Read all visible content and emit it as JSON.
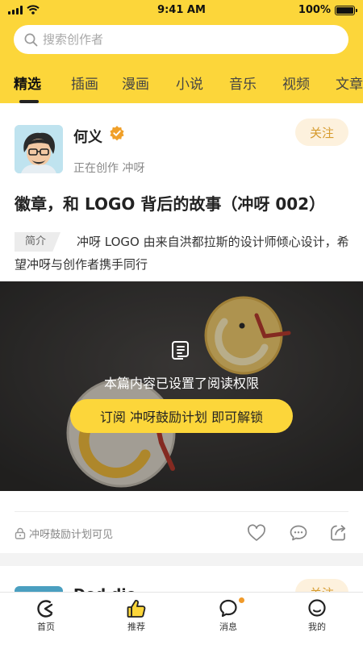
{
  "status_bar": {
    "time": "9:41 AM",
    "battery": "100%"
  },
  "search": {
    "placeholder": "搜索创作者"
  },
  "tabs": [
    {
      "label": "精选",
      "active": true
    },
    {
      "label": "插画"
    },
    {
      "label": "漫画"
    },
    {
      "label": "小说"
    },
    {
      "label": "音乐"
    },
    {
      "label": "视频"
    },
    {
      "label": "文章"
    }
  ],
  "post": {
    "author": {
      "name": "何义",
      "status": "正在创作 冲呀",
      "follow_label": "关注"
    },
    "title": "徽章，和 LOGO 背后的故事（冲呀 002）",
    "intro_label": "简介",
    "intro_text": "冲呀 LOGO 由来自洪都拉斯的设计师倾心设计，希望冲呀与创作者携手同行",
    "locked": {
      "message": "本篇内容已设置了阅读权限",
      "button_label": "订阅 冲呀鼓励计划 即可解锁"
    },
    "visibility": "冲呀鼓励计划可见"
  },
  "next_post": {
    "author_name": "Dod dio",
    "follow_label": "关注"
  },
  "bottom_nav": [
    {
      "label": "首页",
      "icon": "home-icon"
    },
    {
      "label": "推荐",
      "icon": "thumbs-up-icon"
    },
    {
      "label": "消息",
      "icon": "message-icon"
    },
    {
      "label": "我的",
      "icon": "profile-icon"
    }
  ],
  "colors": {
    "accent_yellow": "#fcd63a",
    "follow_text": "#d69b2e",
    "follow_bg": "#fdf1dd",
    "notification_dot": "#f09a2a"
  }
}
